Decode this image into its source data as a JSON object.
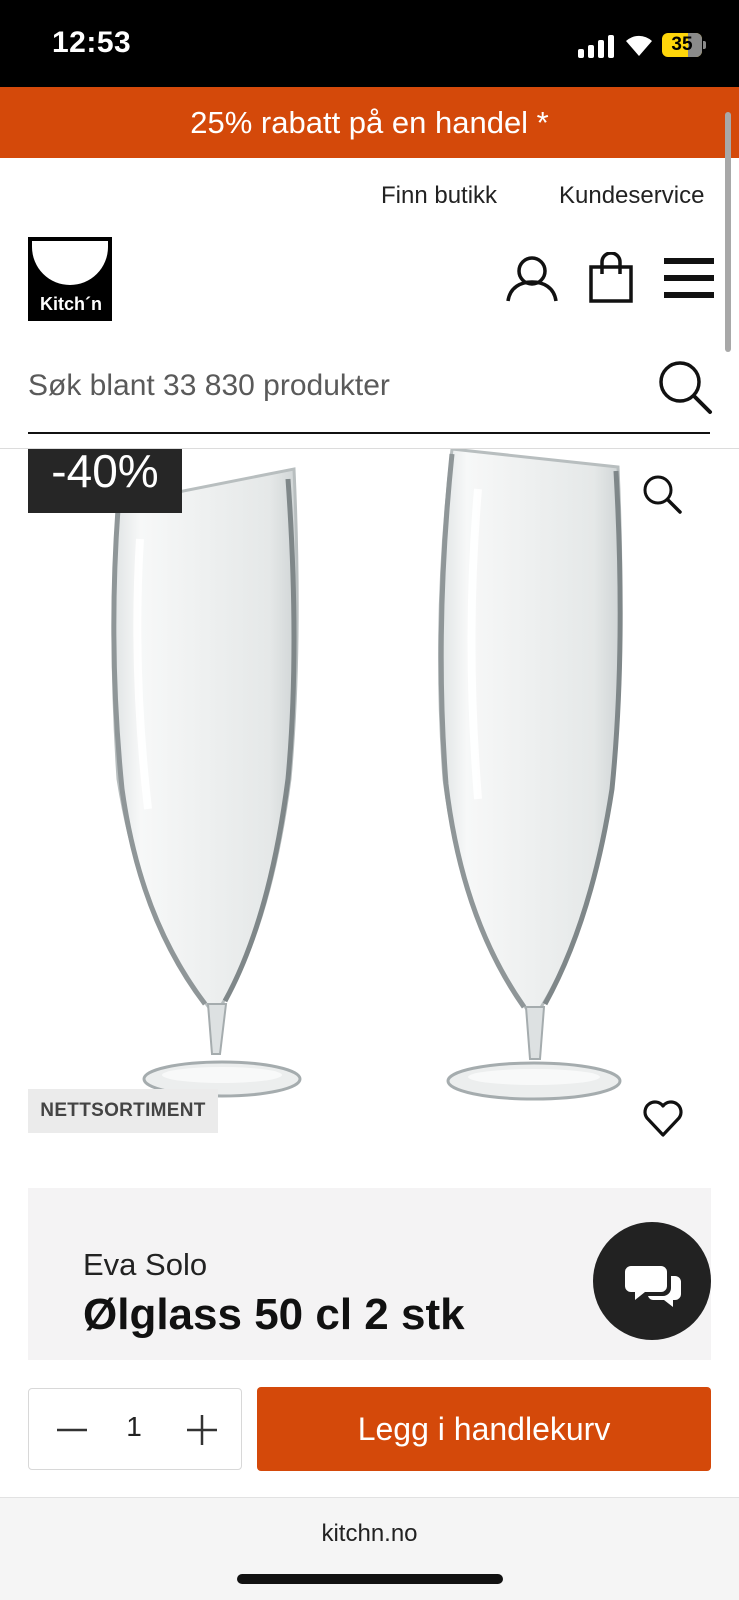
{
  "status_bar": {
    "time": "12:53",
    "battery": "35",
    "battery_color": "#ffd60a"
  },
  "promo": {
    "text": "25% rabatt på en handel *",
    "background": "#d4490a"
  },
  "top_links": {
    "find_store": "Finn butikk",
    "customer_service": "Kundeservice"
  },
  "logo": {
    "text": "Kitch´n"
  },
  "header_icons": [
    "user-icon",
    "shopping-bag-icon",
    "hamburger-menu-icon"
  ],
  "search": {
    "placeholder": "Søk blant 33 830 produkter",
    "icon": "search-icon"
  },
  "product": {
    "discount": "-40%",
    "online_badge": "NETTSORTIMENT",
    "brand": "Eva Solo",
    "title": "Ølglass 50 cl 2 stk",
    "image_icons": [
      "zoom-icon",
      "heart-icon"
    ]
  },
  "chat": {
    "icon": "chat-bubbles-icon"
  },
  "purchase": {
    "quantity": "1",
    "add_to_cart": "Legg i handlekurv",
    "button_color": "#d4490a"
  },
  "browser": {
    "url": "kitchn.no"
  }
}
